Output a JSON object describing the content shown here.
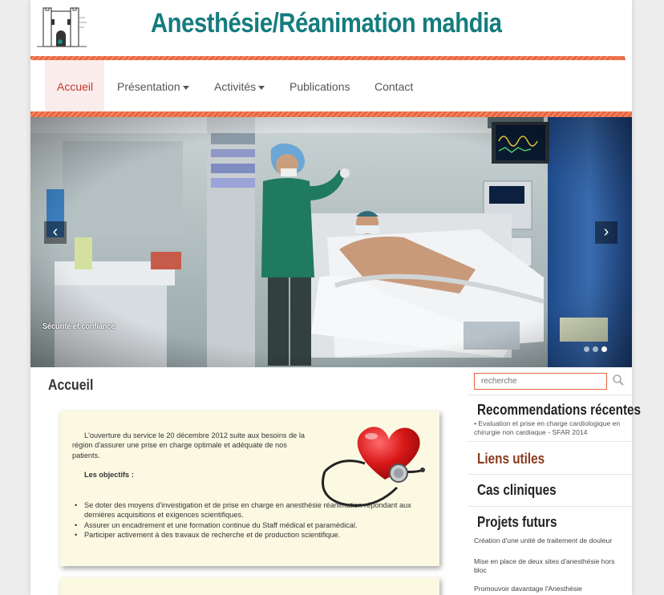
{
  "site": {
    "title": "Anesthésie/Réanimation mahdia"
  },
  "nav": {
    "items": [
      {
        "label": "Accueil",
        "active": true,
        "dropdown": false
      },
      {
        "label": "Présentation",
        "active": false,
        "dropdown": true
      },
      {
        "label": "Activités",
        "active": false,
        "dropdown": true
      },
      {
        "label": "Publications",
        "active": false,
        "dropdown": false
      },
      {
        "label": "Contact",
        "active": false,
        "dropdown": false
      }
    ]
  },
  "slider": {
    "caption": "Sécurité et confiance",
    "prev_icon": "chevron-left-icon",
    "next_icon": "chevron-right-icon",
    "slide_count": 3,
    "active_slide": 3
  },
  "main": {
    "title": "Accueil",
    "intro": "L'ouverture du service le 20 décembre 2012 suite aux besoins de la région d'assurer une prise en charge optimale et adéquate de nos patients.",
    "objectives_title": "Les objectifs :",
    "objectives": [
      "Se doter des moyens d'investigation et de prise en charge en anesthésie réanimation répondant aux dernières acquisitions et exigences scientifiques.",
      "Assurer un encadrement et une formation continue du Staff médical et paramédical.",
      "Participer activement à des travaux de recherche et de production scientifique."
    ]
  },
  "sidebar": {
    "search_placeholder": "recherche",
    "recommendations_title": "Recommendations récentes",
    "recommendation_item": "• Evaluation et prise en charge cardiologique en chirurgie non cardiaque - SFAR 2014",
    "useful_links_title": "Liens utiles",
    "clinical_cases_title": "Cas cliniques",
    "future_projects_title": "Projets futurs",
    "future_projects": [
      "Création d'une unité de traitement de douleur",
      "Mise en place de deux sites d'anesthésie hors bloc",
      "Promouvoir davantage l'Anesthésie"
    ]
  },
  "colors": {
    "brand_teal": "#157c7e",
    "accent_orange": "#e8643f",
    "active_nav_bg": "#fbecec",
    "card_bg": "#fcf9e3",
    "sidebar_link_brown": "#8a3b1e"
  }
}
